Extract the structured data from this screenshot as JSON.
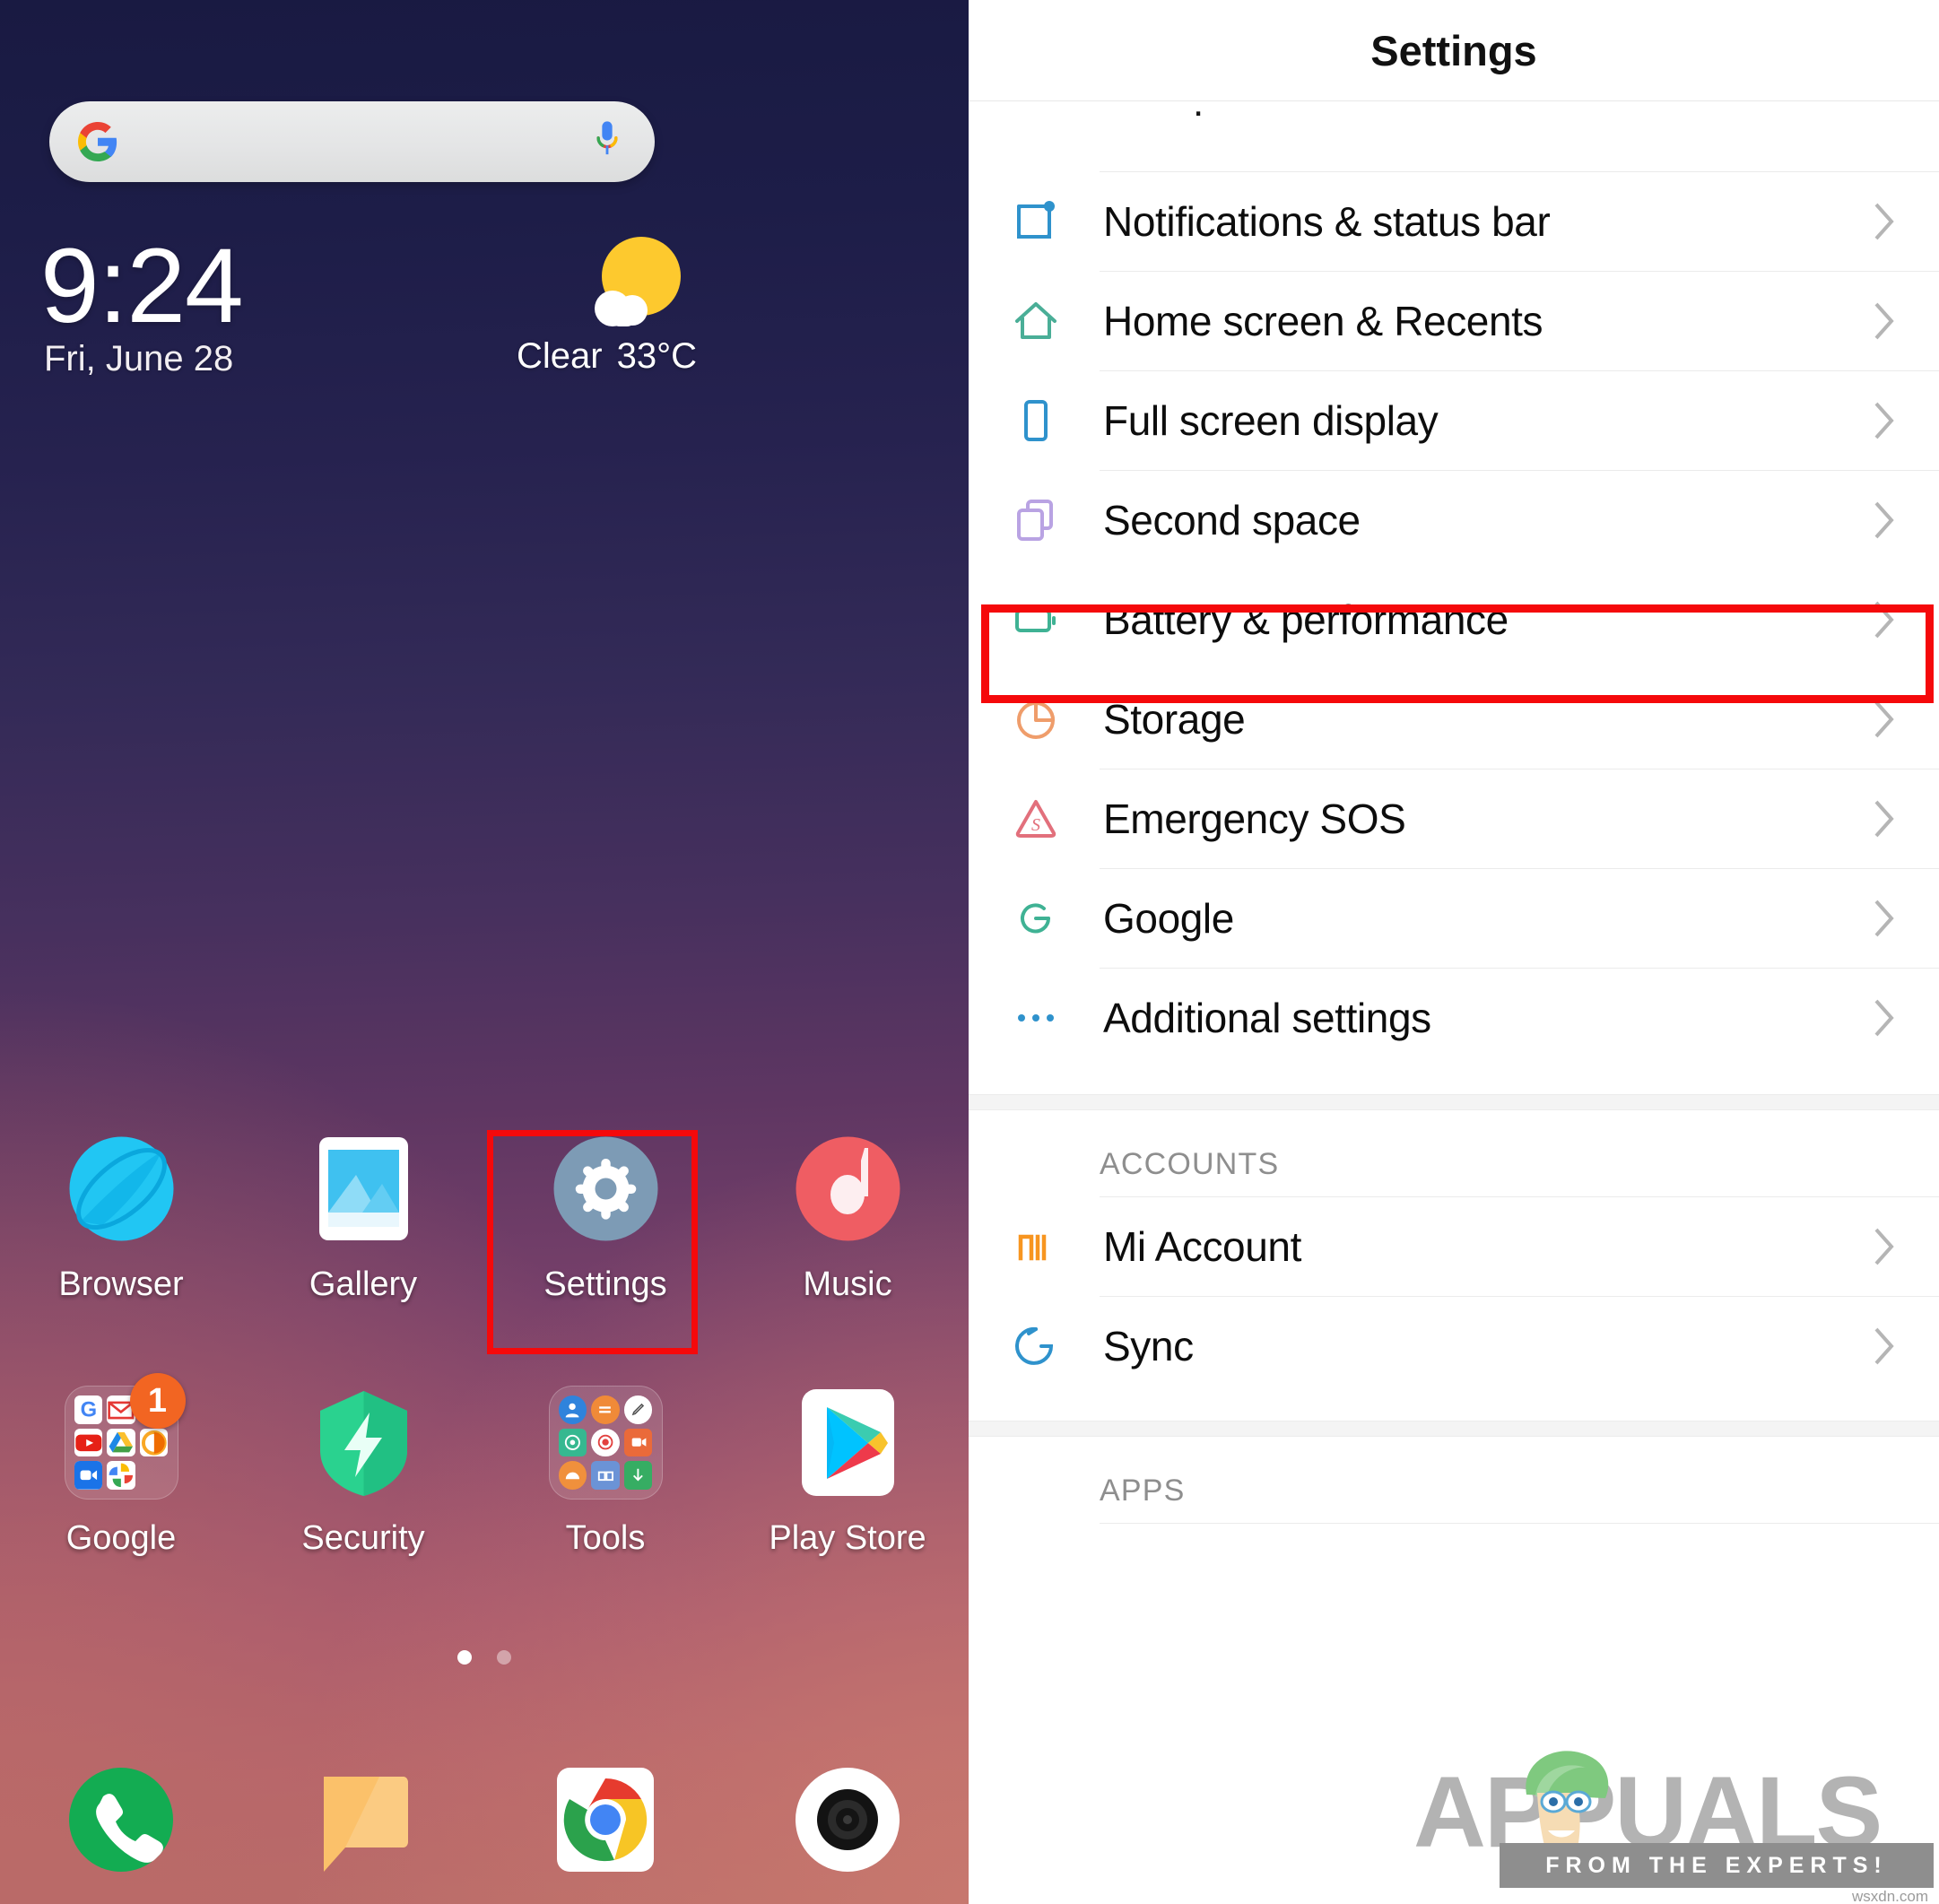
{
  "phone": {
    "search": {
      "placeholder": "",
      "g_icon": "google-g-icon",
      "mic_icon": "microphone-icon"
    },
    "clock": {
      "time": "9:24",
      "date": "Fri, June 28",
      "weather_condition": "Clear",
      "temperature": "33°C",
      "weather_icon": "sun-behind-cloud-icon"
    },
    "apps_row1": [
      {
        "label": "Browser",
        "icon": "browser-icon"
      },
      {
        "label": "Gallery",
        "icon": "gallery-icon"
      },
      {
        "label": "Settings",
        "icon": "settings-gear-icon",
        "highlighted": true
      },
      {
        "label": "Music",
        "icon": "music-note-icon"
      }
    ],
    "apps_row2": [
      {
        "label": "Google",
        "icon": "google-folder-icon",
        "badge": "1"
      },
      {
        "label": "Security",
        "icon": "security-shield-icon"
      },
      {
        "label": "Tools",
        "icon": "tools-folder-icon"
      },
      {
        "label": "Play Store",
        "icon": "play-store-icon"
      }
    ],
    "page_dots": {
      "count": 2,
      "active_index": 0
    },
    "dock": [
      {
        "name": "phone-dialer-icon"
      },
      {
        "name": "messages-icon"
      },
      {
        "name": "chrome-icon"
      },
      {
        "name": "camera-icon"
      }
    ]
  },
  "settings": {
    "title": "Settings",
    "partial_row_above": "",
    "items": [
      {
        "label": "Notifications & status bar",
        "icon": "notifications-icon",
        "color": "#2f92cc"
      },
      {
        "label": "Home screen & Recents",
        "icon": "home-icon",
        "color": "#4aae97"
      },
      {
        "label": "Full screen display",
        "icon": "fullscreen-phone-icon",
        "color": "#2f92cc"
      },
      {
        "label": "Second space",
        "icon": "second-space-icon",
        "color": "#b9a3e3"
      },
      {
        "label": "Battery & performance",
        "icon": "battery-icon",
        "color": "#3fb294",
        "highlighted": true
      },
      {
        "label": "Storage",
        "icon": "storage-pie-icon",
        "color": "#ef9d6b"
      },
      {
        "label": "Emergency SOS",
        "icon": "emergency-sos-icon",
        "color": "#e2707c"
      },
      {
        "label": "Google",
        "icon": "google-g-icon",
        "color": "#3fb294"
      },
      {
        "label": "Additional settings",
        "icon": "ellipsis-icon",
        "color": "#2f92cc"
      }
    ],
    "sections": [
      {
        "heading": "ACCOUNTS",
        "items": [
          {
            "label": "Mi Account",
            "icon": "mi-logo-icon",
            "color": "#f79520"
          },
          {
            "label": "Sync",
            "icon": "sync-icon",
            "color": "#2f92cc"
          }
        ]
      },
      {
        "heading": "APPS",
        "items": []
      }
    ],
    "chevron_icon": "chevron-right-icon"
  },
  "watermark": {
    "brand": "APPUALS",
    "tagline": "FROM THE EXPERTS!",
    "credit": "wsxdn.com"
  },
  "colors": {
    "highlight": "#f5090b",
    "settings_bg": "#ffffff",
    "divider": "#ebebeb",
    "section_text": "#8e8e8e"
  }
}
